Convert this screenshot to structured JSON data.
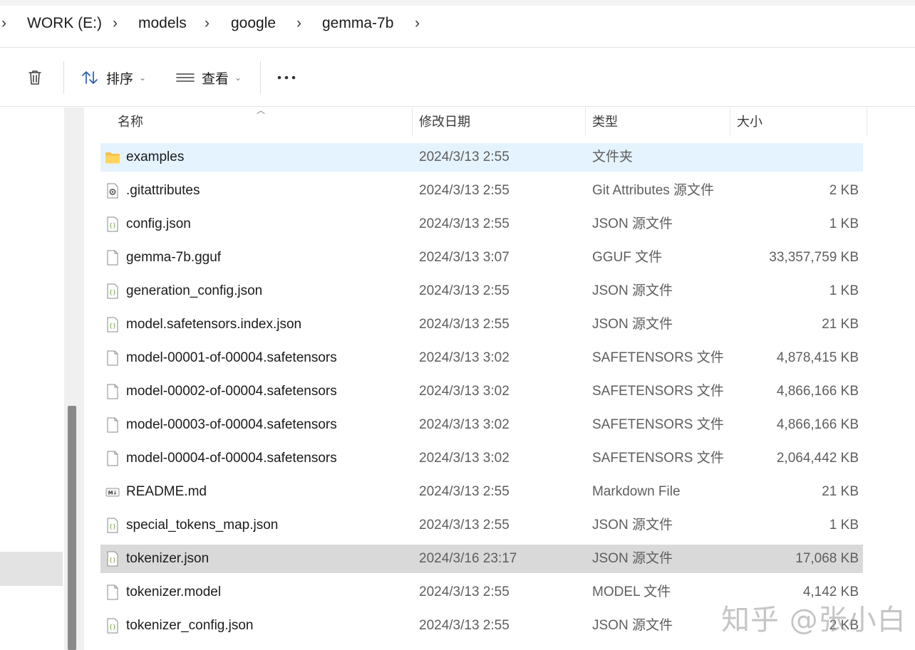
{
  "breadcrumb": {
    "items": [
      "WORK (E:)",
      "models",
      "google",
      "gemma-7b"
    ]
  },
  "toolbar": {
    "delete_icon": "trash-icon",
    "sort_label": "排序",
    "view_label": "查看",
    "more_label": "..."
  },
  "columns": {
    "name": "名称",
    "modified": "修改日期",
    "type": "类型",
    "size": "大小"
  },
  "files": [
    {
      "name": "examples",
      "modified": "2024/3/13 2:55",
      "type": "文件夹",
      "size": "",
      "icon": "folder-icon"
    },
    {
      "name": ".gitattributes",
      "modified": "2024/3/13 2:55",
      "type": "Git Attributes 源文件",
      "size": "2 KB",
      "icon": "gear-file-icon"
    },
    {
      "name": "config.json",
      "modified": "2024/3/13 2:55",
      "type": "JSON 源文件",
      "size": "1 KB",
      "icon": "json-file-icon"
    },
    {
      "name": "gemma-7b.gguf",
      "modified": "2024/3/13 3:07",
      "type": "GGUF 文件",
      "size": "33,357,759 KB",
      "icon": "blank-file-icon"
    },
    {
      "name": "generation_config.json",
      "modified": "2024/3/13 2:55",
      "type": "JSON 源文件",
      "size": "1 KB",
      "icon": "json-file-icon"
    },
    {
      "name": "model.safetensors.index.json",
      "modified": "2024/3/13 2:55",
      "type": "JSON 源文件",
      "size": "21 KB",
      "icon": "json-file-icon"
    },
    {
      "name": "model-00001-of-00004.safetensors",
      "modified": "2024/3/13 3:02",
      "type": "SAFETENSORS 文件",
      "size": "4,878,415 KB",
      "icon": "blank-file-icon"
    },
    {
      "name": "model-00002-of-00004.safetensors",
      "modified": "2024/3/13 3:02",
      "type": "SAFETENSORS 文件",
      "size": "4,866,166 KB",
      "icon": "blank-file-icon"
    },
    {
      "name": "model-00003-of-00004.safetensors",
      "modified": "2024/3/13 3:02",
      "type": "SAFETENSORS 文件",
      "size": "4,866,166 KB",
      "icon": "blank-file-icon"
    },
    {
      "name": "model-00004-of-00004.safetensors",
      "modified": "2024/3/13 3:02",
      "type": "SAFETENSORS 文件",
      "size": "2,064,442 KB",
      "icon": "blank-file-icon"
    },
    {
      "name": "README.md",
      "modified": "2024/3/13 2:55",
      "type": "Markdown File",
      "size": "21 KB",
      "icon": "markdown-file-icon"
    },
    {
      "name": "special_tokens_map.json",
      "modified": "2024/3/13 2:55",
      "type": "JSON 源文件",
      "size": "1 KB",
      "icon": "json-file-icon"
    },
    {
      "name": "tokenizer.json",
      "modified": "2024/3/16 23:17",
      "type": "JSON 源文件",
      "size": "17,068 KB",
      "icon": "json-file-icon"
    },
    {
      "name": "tokenizer.model",
      "modified": "2024/3/13 2:55",
      "type": "MODEL 文件",
      "size": "4,142 KB",
      "icon": "blank-file-icon"
    },
    {
      "name": "tokenizer_config.json",
      "modified": "2024/3/13 2:55",
      "type": "JSON 源文件",
      "size": "2 KB",
      "icon": "json-file-icon"
    }
  ],
  "watermark": "知乎 @张小白",
  "colors": {
    "selected_row": "#e5f3ff",
    "hover_row": "#d9d9d9",
    "folder": "#f4c04a",
    "json_icon": "#6a9e2f"
  }
}
